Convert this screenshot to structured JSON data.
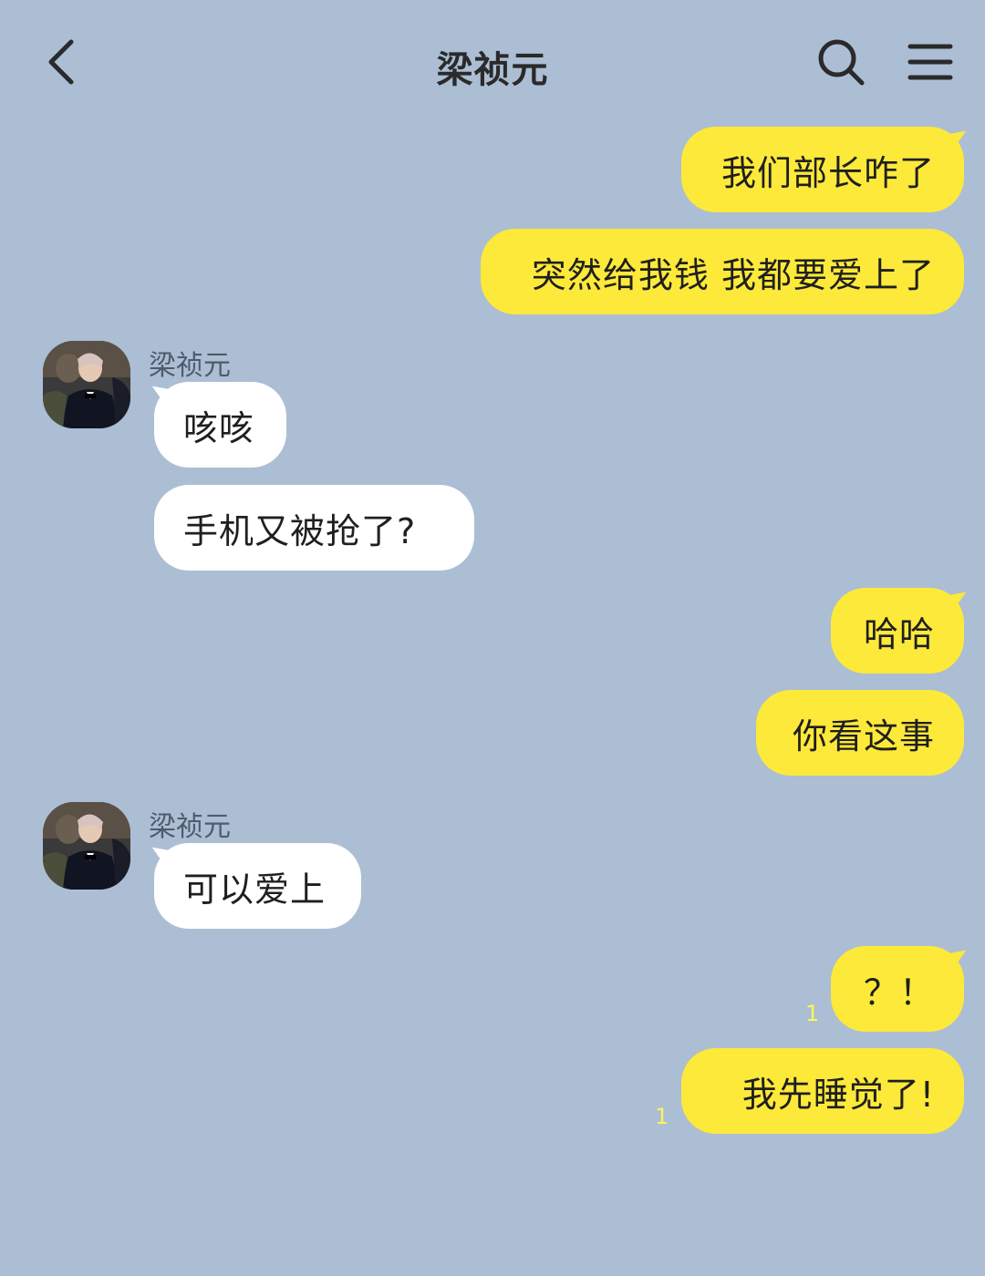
{
  "header": {
    "title": "梁祯元",
    "back_icon": "chevron-left-icon",
    "search_icon": "search-icon",
    "menu_icon": "hamburger-menu-icon"
  },
  "colors": {
    "background": "#abbed4",
    "my_bubble": "#fde93a",
    "their_bubble": "#ffffff",
    "unread": "#fff45c"
  },
  "contact": {
    "name": "梁祯元"
  },
  "messages": [
    {
      "side": "mine",
      "text": "我们部长咋了"
    },
    {
      "side": "mine",
      "text": "突然给我钱 我都要爱上了"
    },
    {
      "side": "theirs",
      "text": "咳咳"
    },
    {
      "side": "theirs",
      "text": "手机又被抢了?"
    },
    {
      "side": "mine",
      "text": "哈哈"
    },
    {
      "side": "mine",
      "text": "你看这事"
    },
    {
      "side": "theirs",
      "text": "可以爱上"
    },
    {
      "side": "mine",
      "text": "？！",
      "unread": "1"
    },
    {
      "side": "mine",
      "text": "我先睡觉了!",
      "unread": "1"
    }
  ]
}
